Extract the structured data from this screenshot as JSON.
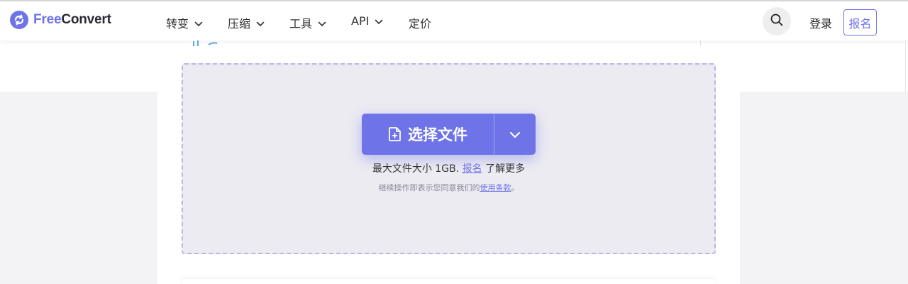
{
  "brand": {
    "name_part1": "Free",
    "name_part2": "Convert",
    "accent": "#6e73e8"
  },
  "nav": {
    "items": [
      {
        "label": "转变",
        "has_dropdown": true
      },
      {
        "label": "压缩",
        "has_dropdown": true
      },
      {
        "label": "工具",
        "has_dropdown": true
      },
      {
        "label": "API",
        "has_dropdown": true
      },
      {
        "label": "定价",
        "has_dropdown": false
      }
    ],
    "search_icon": "search-icon",
    "login_label": "登录",
    "signup_label": "报名"
  },
  "upload": {
    "choose_label": "选择文件",
    "choose_icon": "file-plus-icon",
    "dropdown_icon": "chevron-down-icon",
    "max_size_text": "最大文件大小 1GB.",
    "signup_link": "报名",
    "learn_more_text": "了解更多",
    "terms_prefix": "继续操作即表示您同意我们的",
    "terms_link": "使用条款",
    "terms_suffix": "。"
  }
}
